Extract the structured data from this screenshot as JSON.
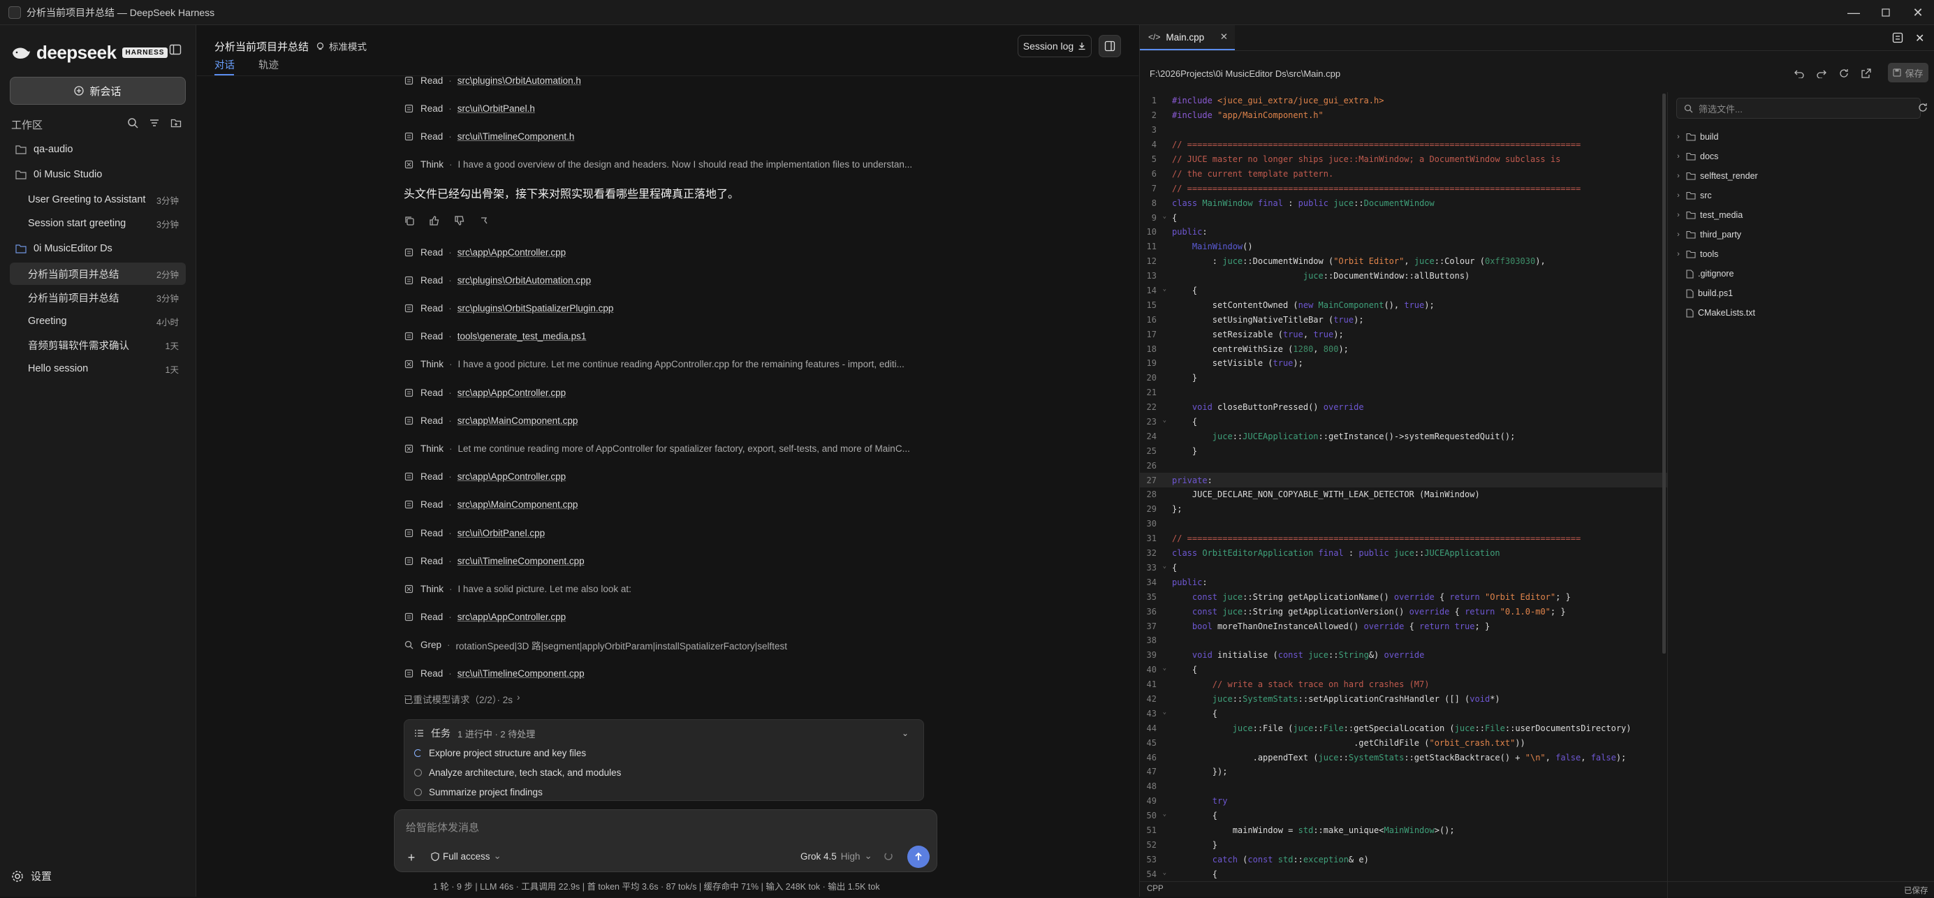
{
  "window": {
    "title": "分析当前项目并总结 — DeepSeek Harness"
  },
  "sidebar": {
    "logo": "deepseek",
    "badge": "HARNESS",
    "new_chat": "新会话",
    "workspace_label": "工作区",
    "workspaces": [
      {
        "name": "qa-audio",
        "sessions": []
      },
      {
        "name": "0i Music Studio",
        "sessions": [
          {
            "title": "User Greeting to Assistant",
            "time": "3分钟"
          },
          {
            "title": "Session start greeting",
            "time": "3分钟"
          }
        ]
      },
      {
        "name": "0i MusicEditor Ds",
        "sessions": [
          {
            "title": "分析当前项目并总结",
            "time": "2分钟"
          },
          {
            "title": "分析当前项目并总结",
            "time": "3分钟"
          },
          {
            "title": "Greeting",
            "time": "4小时"
          },
          {
            "title": "音频剪辑软件需求确认",
            "time": "1天"
          },
          {
            "title": "Hello session",
            "time": "1天"
          }
        ]
      }
    ],
    "settings": "设置"
  },
  "chat": {
    "title": "分析当前项目并总结",
    "mode": "标准模式",
    "tabs": [
      "对话",
      "轨迹"
    ],
    "session_log": "Session log",
    "rows": [
      {
        "kind": "Read",
        "text": "src\\plugins\\OrbitAutomation.h"
      },
      {
        "kind": "Read",
        "text": "src\\ui\\OrbitPanel.h"
      },
      {
        "kind": "Read",
        "text": "src\\ui\\TimelineComponent.h"
      },
      {
        "kind": "Think",
        "text": "I have a good overview of the design and headers. Now I should read the implementation files to understan..."
      }
    ],
    "summary": "头文件已经勾出骨架，接下来对照实现看看哪些里程碑真正落地了。",
    "rows2": [
      {
        "kind": "Read",
        "text": "src\\app\\AppController.cpp"
      },
      {
        "kind": "Read",
        "text": "src\\plugins\\OrbitAutomation.cpp"
      },
      {
        "kind": "Read",
        "text": "src\\plugins\\OrbitSpatializerPlugin.cpp"
      },
      {
        "kind": "Read",
        "text": "tools\\generate_test_media.ps1"
      },
      {
        "kind": "Think",
        "text": "I have a good picture. Let me continue reading AppController.cpp for the remaining features - import, editi..."
      },
      {
        "kind": "Read",
        "text": "src\\app\\AppController.cpp"
      },
      {
        "kind": "Read",
        "text": "src\\app\\MainComponent.cpp"
      },
      {
        "kind": "Think",
        "text": "Let me continue reading more of AppController for spatializer factory, export, self-tests, and more of MainC..."
      },
      {
        "kind": "Read",
        "text": "src\\app\\AppController.cpp"
      },
      {
        "kind": "Read",
        "text": "src\\app\\MainComponent.cpp"
      },
      {
        "kind": "Read",
        "text": "src\\ui\\OrbitPanel.cpp"
      },
      {
        "kind": "Read",
        "text": "src\\ui\\TimelineComponent.cpp"
      },
      {
        "kind": "Think",
        "text": "I have a solid picture. Let me also look at:"
      },
      {
        "kind": "Read",
        "text": "src\\app\\AppController.cpp"
      },
      {
        "kind": "Grep",
        "text": "rotationSpeed|3D 路|segment|applyOrbitParam|installSpatializerFactory|selftest"
      },
      {
        "kind": "Read",
        "text": "src\\ui\\TimelineComponent.cpp"
      }
    ],
    "retry": "已重试模型请求（2/2）· 2s",
    "tasks": {
      "label": "任务",
      "counts": "1 进行中 · 2 待处理",
      "items": [
        {
          "text": "Explore project structure and key files",
          "state": "in-progress"
        },
        {
          "text": "Analyze architecture, tech stack, and modules",
          "state": "pending"
        },
        {
          "text": "Summarize project findings",
          "state": "pending"
        }
      ]
    },
    "input": {
      "placeholder": "给智能体发消息",
      "access": "Full access",
      "model": "Grok 4.5",
      "effort": "High"
    },
    "status": "1 轮 · 9 步 | LLM 46s · 工具调用 22.9s | 首 token 平均 3.6s · 87 tok/s | 缓存命中 71% | 输入 248K tok · 输出 1.5K tok"
  },
  "editor": {
    "tab": "Main.cpp",
    "path": "F:\\2026Projects\\0i MusicEditor Ds\\src\\Main.cpp",
    "save": "保存",
    "filter_placeholder": "筛选文件...",
    "language": "CPP",
    "saved_state": "已保存",
    "tree": [
      {
        "name": "build",
        "type": "folder"
      },
      {
        "name": "docs",
        "type": "folder"
      },
      {
        "name": "selftest_render",
        "type": "folder"
      },
      {
        "name": "src",
        "type": "folder"
      },
      {
        "name": "test_media",
        "type": "folder"
      },
      {
        "name": "third_party",
        "type": "folder"
      },
      {
        "name": "tools",
        "type": "folder"
      },
      {
        "name": ".gitignore",
        "type": "file"
      },
      {
        "name": "build.ps1",
        "type": "file"
      },
      {
        "name": "CMakeLists.txt",
        "type": "file"
      }
    ],
    "lines": [
      [
        [
          "#include ",
          "d"
        ],
        [
          "<juce_gui_extra/juce_gui_extra.h>",
          "s"
        ]
      ],
      [
        [
          "#include ",
          "d"
        ],
        [
          "\"app/MainComponent.h\"",
          "s"
        ]
      ],
      [],
      [
        [
          "// ==============================================================================",
          "c"
        ]
      ],
      [
        [
          "// JUCE master no longer ships juce::MainWindow; a DocumentWindow subclass is",
          "c"
        ]
      ],
      [
        [
          "// the current template pattern.",
          "c"
        ]
      ],
      [
        [
          "// ==============================================================================",
          "c"
        ]
      ],
      [
        [
          "class ",
          "k"
        ],
        [
          "MainWindow ",
          "t"
        ],
        [
          "final ",
          "k"
        ],
        [
          ": ",
          "tx"
        ],
        [
          "public ",
          "k"
        ],
        [
          "juce",
          "t"
        ],
        [
          "::",
          "tx"
        ],
        [
          "DocumentWindow",
          "t"
        ]
      ],
      [
        [
          "{",
          "tx"
        ]
      ],
      [
        [
          "public",
          "k"
        ],
        [
          ":",
          "tx"
        ]
      ],
      [
        [
          "    ",
          "tx"
        ],
        [
          "MainWindow",
          "g"
        ],
        [
          "()",
          "tx"
        ]
      ],
      [
        [
          "        : ",
          "tx"
        ],
        [
          "juce",
          "t"
        ],
        [
          "::DocumentWindow (",
          "tx"
        ],
        [
          "\"Orbit Editor\"",
          "s"
        ],
        [
          ", ",
          "tx"
        ],
        [
          "juce",
          "t"
        ],
        [
          "::Colour (",
          "tx"
        ],
        [
          "0xff303030",
          "n"
        ],
        [
          "),",
          "tx"
        ]
      ],
      [
        [
          "                          ",
          "tx"
        ],
        [
          "juce",
          "t"
        ],
        [
          "::DocumentWindow::allButtons)",
          "tx"
        ]
      ],
      [
        [
          "    {",
          "tx"
        ]
      ],
      [
        [
          "        setContentOwned (",
          "tx"
        ],
        [
          "new ",
          "k"
        ],
        [
          "MainComponent",
          "t"
        ],
        [
          "(), ",
          "tx"
        ],
        [
          "true",
          "k"
        ],
        [
          ");",
          "tx"
        ]
      ],
      [
        [
          "        setUsingNativeTitleBar (",
          "tx"
        ],
        [
          "true",
          "k"
        ],
        [
          ");",
          "tx"
        ]
      ],
      [
        [
          "        setResizable (",
          "tx"
        ],
        [
          "true",
          "k"
        ],
        [
          ", ",
          "tx"
        ],
        [
          "true",
          "k"
        ],
        [
          ");",
          "tx"
        ]
      ],
      [
        [
          "        centreWithSize (",
          "tx"
        ],
        [
          "1280",
          "n"
        ],
        [
          ", ",
          "tx"
        ],
        [
          "800",
          "n"
        ],
        [
          ");",
          "tx"
        ]
      ],
      [
        [
          "        setVisible (",
          "tx"
        ],
        [
          "true",
          "k"
        ],
        [
          ");",
          "tx"
        ]
      ],
      [
        [
          "    }",
          "tx"
        ]
      ],
      [],
      [
        [
          "    void ",
          "k"
        ],
        [
          "closeButtonPressed() ",
          "tx"
        ],
        [
          "override",
          "k"
        ]
      ],
      [
        [
          "    {",
          "tx"
        ]
      ],
      [
        [
          "        ",
          "tx"
        ],
        [
          "juce",
          "t"
        ],
        [
          "::",
          "tx"
        ],
        [
          "JUCEApplication",
          "t"
        ],
        [
          "::getInstance()->systemRequestedQuit();",
          "tx"
        ]
      ],
      [
        [
          "    }",
          "tx"
        ]
      ],
      [],
      [
        [
          "private",
          "k"
        ],
        [
          ":",
          "tx"
        ]
      ],
      [
        [
          "    JUCE_DECLARE_NON_COPYABLE_WITH_LEAK_DETECTOR (MainWindow)",
          "tx"
        ]
      ],
      [
        [
          "};",
          "tx"
        ]
      ],
      [],
      [
        [
          "// ==============================================================================",
          "c"
        ]
      ],
      [
        [
          "class ",
          "k"
        ],
        [
          "OrbitEditorApplication ",
          "t"
        ],
        [
          "final ",
          "k"
        ],
        [
          ": ",
          "tx"
        ],
        [
          "public ",
          "k"
        ],
        [
          "juce",
          "t"
        ],
        [
          "::",
          "tx"
        ],
        [
          "JUCEApplication",
          "t"
        ]
      ],
      [
        [
          "{",
          "tx"
        ]
      ],
      [
        [
          "public",
          "k"
        ],
        [
          ":",
          "tx"
        ]
      ],
      [
        [
          "    const ",
          "k"
        ],
        [
          "juce",
          "t"
        ],
        [
          "::String getApplicationName() ",
          "tx"
        ],
        [
          "override ",
          "k"
        ],
        [
          "{ ",
          "tx"
        ],
        [
          "return ",
          "k"
        ],
        [
          "\"Orbit Editor\"",
          "s"
        ],
        [
          "; }",
          "tx"
        ]
      ],
      [
        [
          "    const ",
          "k"
        ],
        [
          "juce",
          "t"
        ],
        [
          "::String getApplicationVersion() ",
          "tx"
        ],
        [
          "override ",
          "k"
        ],
        [
          "{ ",
          "tx"
        ],
        [
          "return ",
          "k"
        ],
        [
          "\"0.1.0-m0\"",
          "s"
        ],
        [
          "; }",
          "tx"
        ]
      ],
      [
        [
          "    bool ",
          "k"
        ],
        [
          "moreThanOneInstanceAllowed() ",
          "tx"
        ],
        [
          "override ",
          "k"
        ],
        [
          "{ ",
          "tx"
        ],
        [
          "return ",
          "k"
        ],
        [
          "true",
          "k"
        ],
        [
          "; }",
          "tx"
        ]
      ],
      [],
      [
        [
          "    void ",
          "k"
        ],
        [
          "initialise (",
          "tx"
        ],
        [
          "const ",
          "k"
        ],
        [
          "juce",
          "t"
        ],
        [
          "::",
          "tx"
        ],
        [
          "String",
          "t"
        ],
        [
          "&) ",
          "tx"
        ],
        [
          "override",
          "k"
        ]
      ],
      [
        [
          "    {",
          "tx"
        ]
      ],
      [
        [
          "        // write a stack trace on hard crashes (M7)",
          "c"
        ]
      ],
      [
        [
          "        ",
          "tx"
        ],
        [
          "juce",
          "t"
        ],
        [
          "::",
          "tx"
        ],
        [
          "SystemStats",
          "t"
        ],
        [
          "::setApplicationCrashHandler ([] (",
          "tx"
        ],
        [
          "void",
          "k"
        ],
        [
          "*)",
          "tx"
        ]
      ],
      [
        [
          "        {",
          "tx"
        ]
      ],
      [
        [
          "            ",
          "tx"
        ],
        [
          "juce",
          "t"
        ],
        [
          "::File (",
          "tx"
        ],
        [
          "juce",
          "t"
        ],
        [
          "::",
          "tx"
        ],
        [
          "File",
          "t"
        ],
        [
          "::getSpecialLocation (",
          "tx"
        ],
        [
          "juce",
          "t"
        ],
        [
          "::",
          "tx"
        ],
        [
          "File",
          "t"
        ],
        [
          "::userDocumentsDirectory)",
          "tx"
        ]
      ],
      [
        [
          "                                    .getChildFile (",
          "tx"
        ],
        [
          "\"orbit_crash.txt\"",
          "s"
        ],
        [
          "))",
          "tx"
        ]
      ],
      [
        [
          "                .appendText (",
          "tx"
        ],
        [
          "juce",
          "t"
        ],
        [
          "::",
          "tx"
        ],
        [
          "SystemStats",
          "t"
        ],
        [
          "::getStackBacktrace() + ",
          "tx"
        ],
        [
          "\"\\n\"",
          "s"
        ],
        [
          ", ",
          "tx"
        ],
        [
          "false",
          "k"
        ],
        [
          ", ",
          "tx"
        ],
        [
          "false",
          "k"
        ],
        [
          ");",
          "tx"
        ]
      ],
      [
        [
          "        });",
          "tx"
        ]
      ],
      [],
      [
        [
          "        try",
          "k"
        ]
      ],
      [
        [
          "        {",
          "tx"
        ]
      ],
      [
        [
          "            mainWindow = ",
          "tx"
        ],
        [
          "std",
          "t"
        ],
        [
          "::make_unique<",
          "tx"
        ],
        [
          "MainWindow",
          "t"
        ],
        [
          ">();",
          "tx"
        ]
      ],
      [
        [
          "        }",
          "tx"
        ]
      ],
      [
        [
          "        catch ",
          "k"
        ],
        [
          "(",
          "tx"
        ],
        [
          "const ",
          "k"
        ],
        [
          "std",
          "t"
        ],
        [
          "::",
          "tx"
        ],
        [
          "exception",
          "t"
        ],
        [
          "& e)",
          "tx"
        ]
      ],
      [
        [
          "        {",
          "tx"
        ]
      ]
    ]
  }
}
